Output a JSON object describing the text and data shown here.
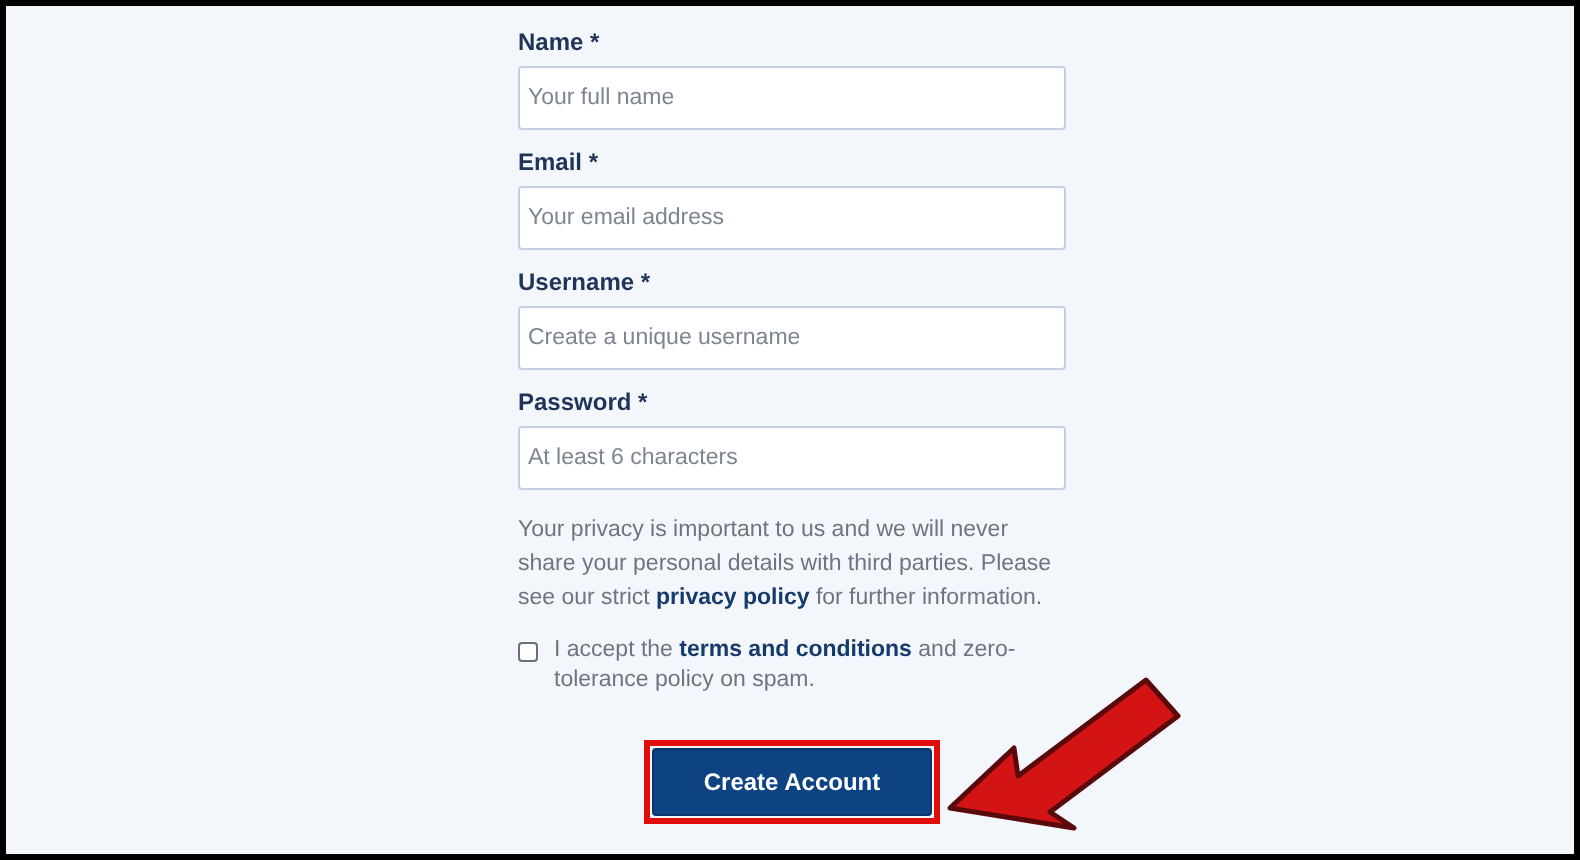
{
  "form": {
    "fields": [
      {
        "label": "Name *",
        "placeholder": "Your full name"
      },
      {
        "label": "Email *",
        "placeholder": "Your email address"
      },
      {
        "label": "Username *",
        "placeholder": "Create a unique username"
      },
      {
        "label": "Password *",
        "placeholder": "At least 6 characters"
      }
    ],
    "privacy_notice": {
      "before": "Your privacy is important to us and we will never share your personal details with third parties. Please see our strict ",
      "link": "privacy policy",
      "after": " for further information."
    },
    "consent": {
      "checked": false,
      "before": "I accept the ",
      "link": "terms and conditions",
      "after": " and zero-tolerance policy on spam."
    },
    "submit": "Create Account"
  }
}
